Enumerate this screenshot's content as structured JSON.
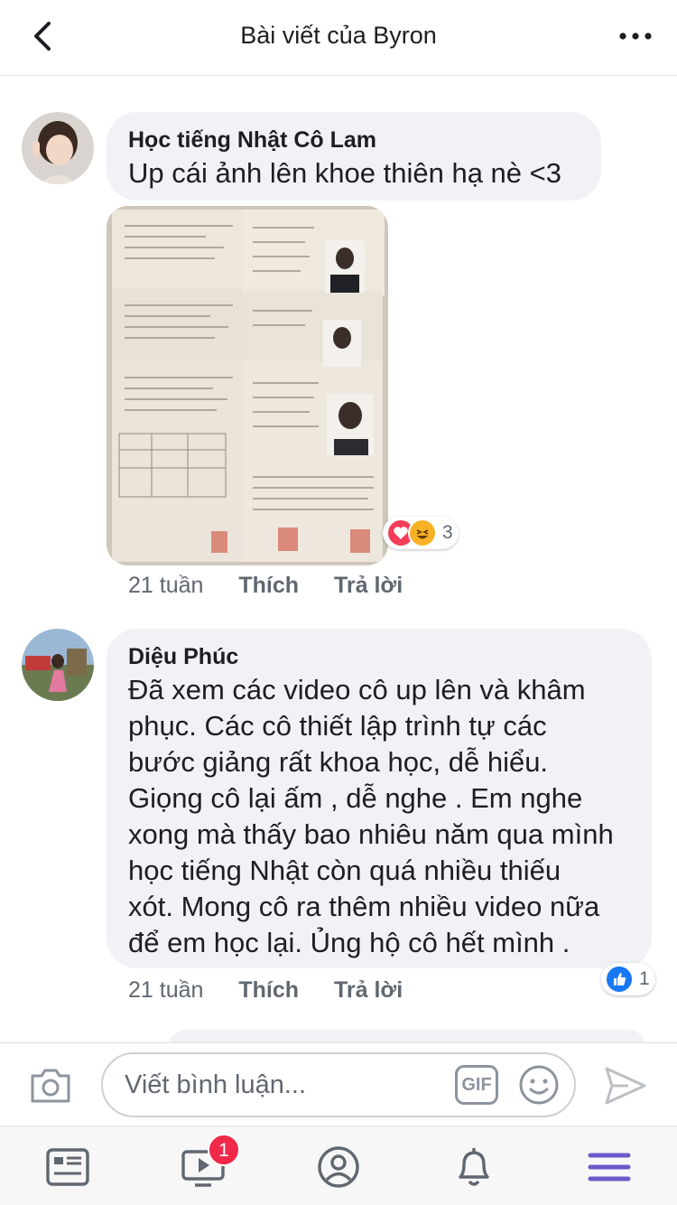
{
  "header": {
    "title": "Bài viết của Byron",
    "back_icon": "chevron-left-icon",
    "more_icon": "more-icon"
  },
  "comments": [
    {
      "author": "Học tiếng Nhật Cô Lam",
      "text": "Up cái ảnh lên khoe thiên hạ nè <3",
      "time": "21 tuần",
      "like_label": "Thích",
      "reply_label": "Trả lời",
      "reactions": {
        "count": "3",
        "icons": [
          "love-icon",
          "haha-icon"
        ]
      },
      "photo_alt": "JLPT certificates photo"
    },
    {
      "author": "Diệu Phúc",
      "text_lines": [
        "Đã xem các video cô up lên và khâm",
        "phục. Các cô thiết lập trình tự các",
        "bước giảng rất khoa học, dễ hiểu.",
        "Giọng cô lại ấm , dễ nghe . Em nghe",
        "xong mà thấy bao nhiêu năm qua mình",
        "học tiếng Nhật còn quá nhiều thiếu",
        "xót. Mong cô ra thêm nhiều video nữa",
        "để em học lại. Ủng hộ cô hết mình ."
      ],
      "time": "21 tuần",
      "like_label": "Thích",
      "reply_label": "Trả lời",
      "reactions": {
        "count": "1",
        "icons": [
          "like-icon"
        ]
      }
    }
  ],
  "composer": {
    "placeholder": "Viết bình luận...",
    "gif_label": "GIF"
  },
  "tabbar": {
    "video_badge": "1"
  },
  "colors": {
    "bubble": "#f0f2f5",
    "badge": "#f02849",
    "like_blue": "#1877f2",
    "love_red": "#f33e58",
    "menu_purple": "#6b5bc9"
  }
}
